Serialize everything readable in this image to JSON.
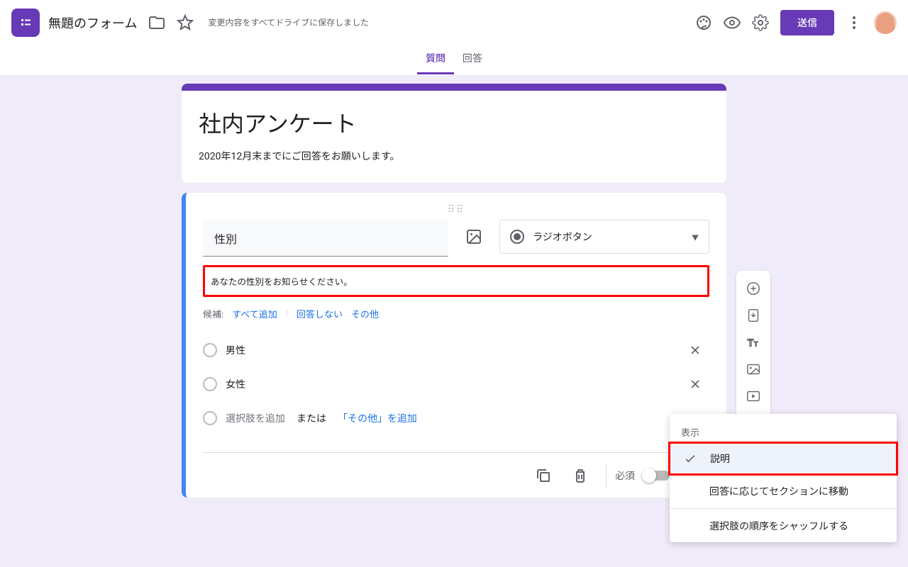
{
  "header": {
    "title": "無題のフォーム",
    "saveStatus": "変更内容をすべてドライブに保存しました",
    "sendButton": "送信"
  },
  "tabs": {
    "questions": "質問",
    "responses": "回答"
  },
  "form": {
    "title": "社内アンケート",
    "description": "2020年12月末までにご回答をお願いします。"
  },
  "question": {
    "title": "性別",
    "typeLabel": "ラジオボタン",
    "descText": "あなたの性別をお知らせください。",
    "suggestions": {
      "label": "候補:",
      "addAll": "すべて追加",
      "noAnswer": "回答しない",
      "other": "その他"
    },
    "options": {
      "opt1": "男性",
      "opt2": "女性",
      "addPlaceholder": "選択肢を追加",
      "or": "または",
      "addOther": "「その他」を追加"
    },
    "footer": {
      "required": "必須"
    }
  },
  "popup": {
    "header": "表示",
    "item1": "説明",
    "item2": "回答に応じてセクションに移動",
    "item3": "選択肢の順序をシャッフルする"
  }
}
